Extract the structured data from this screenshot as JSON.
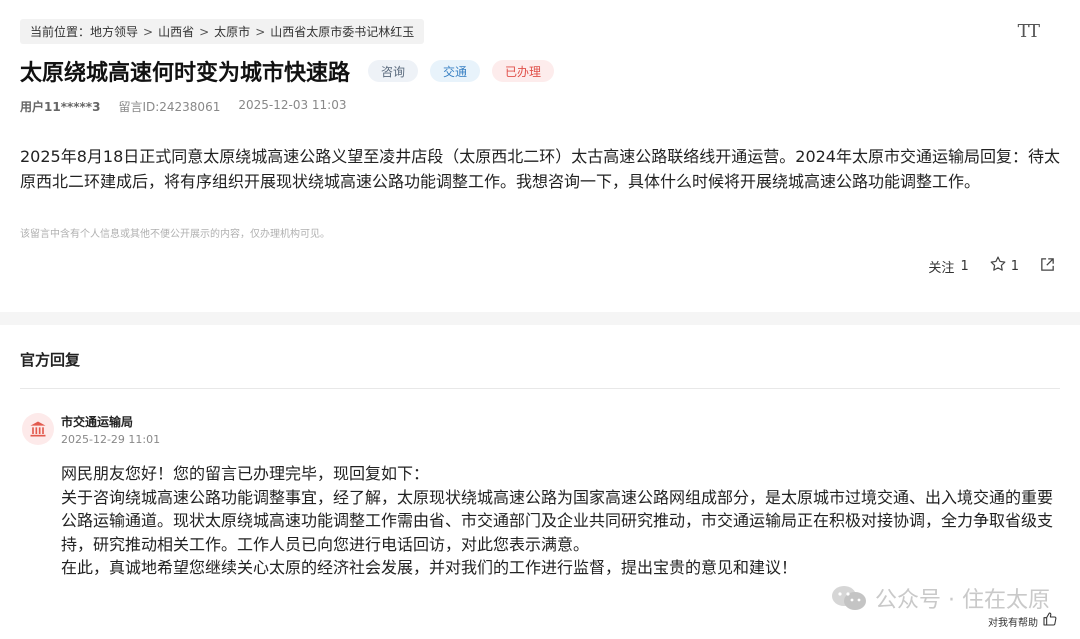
{
  "breadcrumb": {
    "prefix": "当前位置：",
    "items": [
      "地方领导",
      "山西省",
      "太原市",
      "山西省太原市委书记林红玉"
    ],
    "separator": ">"
  },
  "font_size_button": {
    "label": "TT",
    "icon": "font-size-icon"
  },
  "post": {
    "title": "太原绕城高速何时变为城市快速路",
    "tags": [
      {
        "label": "咨询",
        "color": "#5a6a7d"
      },
      {
        "label": "交通",
        "color": "#3b82c4"
      },
      {
        "label": "已办理",
        "color": "#e0504a"
      }
    ],
    "user": "用户11*****3",
    "message_id": "留言ID:24238061",
    "date": "2025-12-03 11:03",
    "content": "2025年8月18日正式同意太原绕城高速公路义望至凌井店段（太原西北二环）太古高速公路联络线开通运营。2024年太原市交通运输局回复：待太原西北二环建成后，将有序组织开展现状绕城高速公路功能调整工作。我想咨询一下，具体什么时候将开展绕城高速公路功能调整工作。",
    "privacy_note": "该留言中含有个人信息或其他不便公开展示的内容，仅办理机构可见。"
  },
  "actions": {
    "follow_label": "关注",
    "follow_count": "1",
    "star_count": "1",
    "star_icon": "star-icon",
    "share_icon": "share-icon"
  },
  "official_reply": {
    "section_title": "官方回复",
    "org_name": "市交通运输局",
    "org_icon": "government-building-icon",
    "time": "2025-12-29 11:01",
    "paragraphs": [
      "网民朋友您好！您的留言已办理完毕，现回复如下：",
      "关于咨询绕城高速公路功能调整事宜，经了解，太原现状绕城高速公路为国家高速公路网组成部分，是太原城市过境交通、出入境交通的重要公路运输通道。现状太原绕城高速功能调整工作需由省、市交通部门及企业共同研究推动，市交通运输局正在积极对接协调，全力争取省级支持，研究推动相关工作。工作人员已向您进行电话回访，对此您表示满意。",
      "在此，真诚地希望您继续关心太原的经济社会发展，并对我们的工作进行监督，提出宝贵的意见和建议！"
    ],
    "helpful_label": "对我有帮助",
    "helpful_icon": "thumbs-up-icon"
  },
  "watermark": {
    "text": "公众号 · 住在太原",
    "icon": "wechat-icon"
  }
}
